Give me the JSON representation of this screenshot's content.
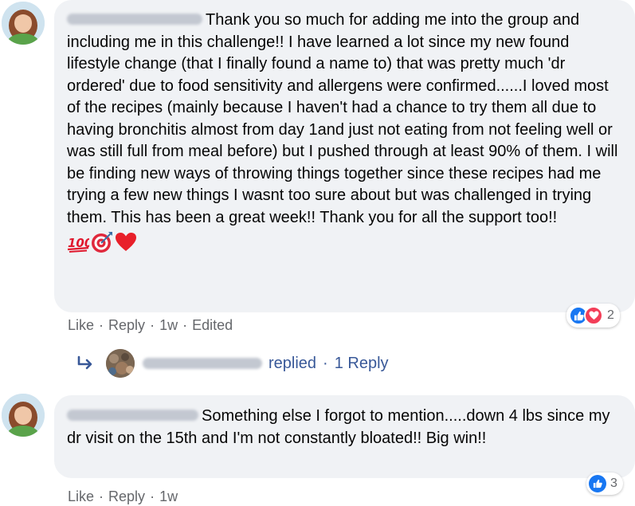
{
  "comments": [
    {
      "text": "Thank you so much for adding me into the group and including me in this challenge!! I have learned a lot since my new found lifestyle change (that I finally found a name to) that was pretty much 'dr ordered' due to food sensitivity and allergens were confirmed......I loved most of the recipes (mainly because I haven't had a chance to try them all due to having bronchitis almost from day 1and just not eating from not feeling well or was still full from meal before) but I pushed through at least 90% of them. I will be finding new ways of throwing things together since these recipes had me trying a few new things I wasnt too sure about but was challenged in trying them. This has been a great week!! Thank you for all the support too!!",
      "emojis": [
        "hundred-points-emoji",
        "direct-hit-emoji",
        "red-heart-emoji"
      ],
      "reaction_count": "2",
      "actions": {
        "like": "Like",
        "reply": "Reply",
        "time": "1w",
        "edited": "Edited"
      },
      "reply_summary": {
        "replied": "replied",
        "count": "1 Reply"
      }
    },
    {
      "text": "Something else I forgot to mention.....down 4 lbs since my dr visit on the 15th and I'm not constantly bloated!! Big win!!",
      "reaction_count": "3",
      "actions": {
        "like": "Like",
        "reply": "Reply",
        "time": "1w"
      }
    }
  ],
  "colors": {
    "bubble": "#f0f2f5",
    "meta": "#65676b",
    "link": "#385898",
    "like_blue": "#1877f2",
    "love_red": "#f33e58"
  }
}
